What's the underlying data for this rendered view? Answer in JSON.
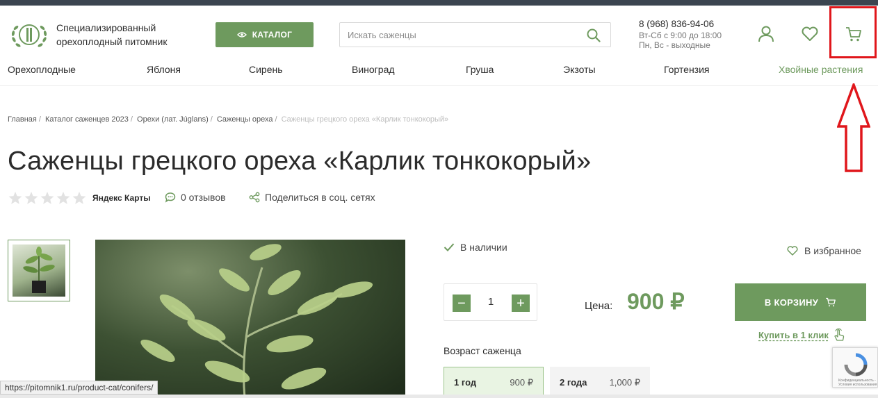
{
  "brand": {
    "name_line1": "Специализированный",
    "name_line2": "орехоплодный питомник"
  },
  "header": {
    "catalog_label": "КАТАЛОГ",
    "search_placeholder": "Искать саженцы",
    "phone": "8 (968) 836-94-06",
    "hours_line1": "Вт-Сб с 9:00 до 18:00",
    "hours_line2": "Пн, Вс - выходные"
  },
  "nav": {
    "items": [
      {
        "label": "Орехоплодные"
      },
      {
        "label": "Яблоня"
      },
      {
        "label": "Сирень"
      },
      {
        "label": "Виноград"
      },
      {
        "label": "Груша"
      },
      {
        "label": "Экзоты"
      },
      {
        "label": "Гортензия"
      },
      {
        "label": "Хвойные растения"
      }
    ]
  },
  "breadcrumb": {
    "items": [
      "Главная",
      "Каталог саженцев 2023",
      "Орехи (лат. Júglans)",
      "Саженцы ореха"
    ],
    "current": "Саженцы грецкого ореха «Карлик тонкокорый»"
  },
  "product": {
    "title": "Саженцы грецкого ореха «Карлик тонкокорый»",
    "rating_source": "Яндекс Карты",
    "reviews": "0 отзывов",
    "share": "Поделиться в соц. сетях",
    "stock": "В наличии",
    "favorite": "В избранное",
    "quantity": "1",
    "price_label": "Цена:",
    "price": "900 ₽",
    "to_cart": "В КОРЗИНУ",
    "one_click": "Купить в 1 клик",
    "age_title": "Возраст саженца",
    "ages": [
      {
        "label": "1 год",
        "price": "900 ₽"
      },
      {
        "label": "2 года",
        "price": "1,000 ₽"
      }
    ]
  },
  "status_bar": {
    "url": "https://pitomnik1.ru/product-cat/conifers/"
  },
  "recaptcha": {
    "text": "Конфиденциальность - Условия использования"
  },
  "colors": {
    "accent": "#6e9a5e",
    "annotation": "#e0161b"
  }
}
